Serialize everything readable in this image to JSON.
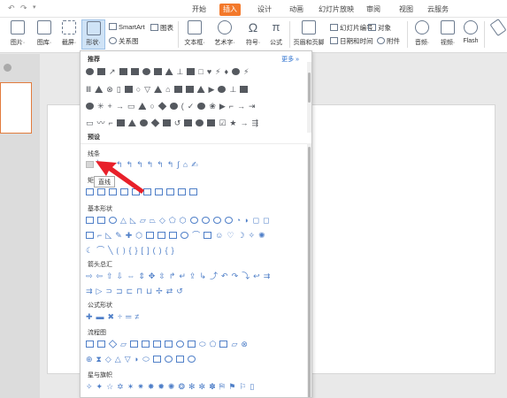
{
  "tabs": [
    "开始",
    "插入",
    "设计",
    "动画",
    "幻灯片放映",
    "审阅",
    "视图",
    "云服务"
  ],
  "active_tab": "插入",
  "ribbon": {
    "picture": "图片·",
    "gallery": "图库·",
    "screenshot": "截屏·",
    "shape": "形状·",
    "smartart": "SmartArt",
    "chart": "图表",
    "relation": "关系图",
    "textbox": "文本框·",
    "wordart": "艺术字·",
    "symbol": "符号·",
    "formula": "公式",
    "header_footer": "页眉和页脚",
    "slide_number": "幻灯片编号",
    "object": "对象",
    "datetime": "日期和时间",
    "attachment": "附件",
    "audio": "音频·",
    "video": "视频·",
    "flash": "Flash"
  },
  "panel": {
    "recommended": "推荐",
    "more": "更多 »",
    "preset": "预设",
    "sections": [
      "线条",
      "矩形",
      "基本形状",
      "箭头总汇",
      "公式形状",
      "流程图",
      "星与旗帜"
    ],
    "tooltip": "直线"
  },
  "colors": {
    "accent": "#f3792b",
    "arrow": "#e8202a",
    "shape_blue": "#4f7fc8"
  }
}
